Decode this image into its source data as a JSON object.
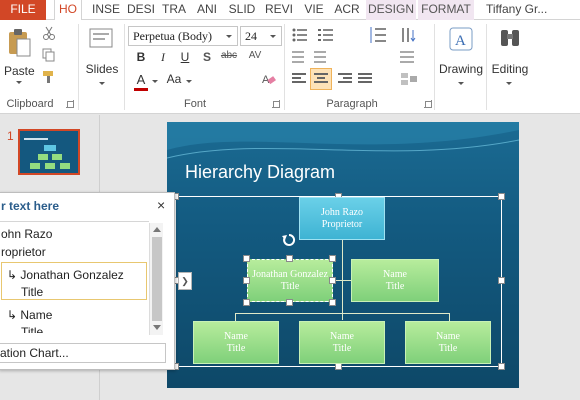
{
  "tabs": [
    "FILE",
    "HO",
    "INSE",
    "DESI",
    "TRA",
    "ANI",
    "SLID",
    "REVI",
    "VIE",
    "ACR",
    "DESIGN",
    "FORMAT"
  ],
  "user": "Tiffany Gr...",
  "ribbon": {
    "clipboard": {
      "label": "Clipboard",
      "paste": "Paste"
    },
    "slides": {
      "label": "Slides"
    },
    "font": {
      "label": "Font",
      "family": "Perpetua (Body)",
      "size": "24"
    },
    "paragraph": {
      "label": "Paragraph"
    },
    "drawing": {
      "label": "Drawing"
    },
    "editing": {
      "label": "Editing"
    }
  },
  "thumbnail": {
    "number": "1"
  },
  "slide": {
    "title": "Hierarchy Diagram",
    "nodes": {
      "top": {
        "name": "John Razo",
        "role": "Proprietor"
      },
      "mid_left": {
        "name": "Jonathan Gonzalez",
        "role": "Title"
      },
      "mid_right": {
        "name": "Name",
        "role": "Title"
      },
      "bottom_1": {
        "name": "Name",
        "role": "Title"
      },
      "bottom_2": {
        "name": "Name",
        "role": "Title"
      },
      "bottom_3": {
        "name": "Name",
        "role": "Title"
      }
    }
  },
  "text_pane": {
    "title": "r text here",
    "close": "×",
    "items": [
      {
        "text": "ohn Razo"
      },
      {
        "text": "roprietor"
      },
      {
        "text": "↳ Jonathan Gonzalez"
      },
      {
        "text": "Title"
      },
      {
        "text": "↳ Name"
      },
      {
        "text": "Title"
      }
    ],
    "footer": "ation Chart..."
  },
  "colors": {
    "accent": "#d24726",
    "slide_bg": "#135a80",
    "node_blue": "#3eb3d3",
    "node_green": "#7fd07a"
  },
  "icons": [
    "cut-icon",
    "copy-icon",
    "format-painter-icon",
    "new-slide-icon",
    "bold-icon",
    "italic-icon",
    "underline-icon",
    "shadow-icon",
    "strikethrough-icon",
    "char-spacing-icon",
    "font-color-icon",
    "change-case-icon",
    "clear-format-icon",
    "bullets-icon",
    "numbering-icon",
    "indent-icon",
    "align-left-icon",
    "align-center-icon",
    "align-right-icon",
    "justify-icon",
    "drawing-icon",
    "binoculars-icon",
    "rotate-handle-icon",
    "expand-arrow-icon"
  ]
}
